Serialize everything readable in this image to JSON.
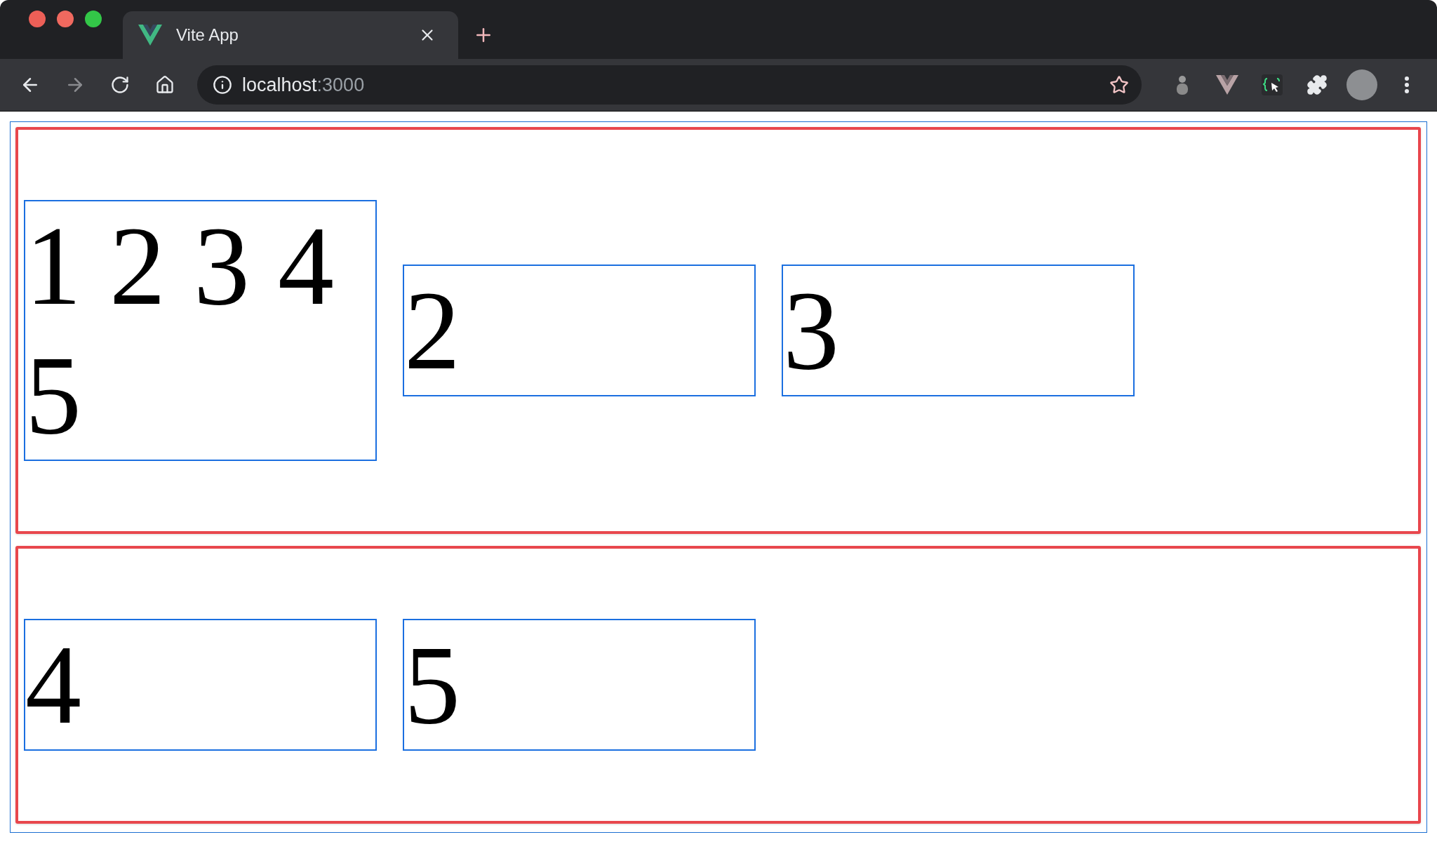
{
  "tab": {
    "title": "Vite App",
    "selected": true
  },
  "nav": [
    {
      "kind": "back",
      "disabled": false
    },
    {
      "kind": "forward",
      "disabled": true
    },
    {
      "kind": "reload",
      "disabled": false
    },
    {
      "kind": "home",
      "disabled": false
    }
  ],
  "address": {
    "host": "localhost",
    "port": ":3000"
  },
  "rows": [
    {
      "boxes": [
        "1 2 3 4 5",
        "2",
        "3"
      ]
    },
    {
      "boxes": [
        "4",
        "5"
      ]
    }
  ]
}
